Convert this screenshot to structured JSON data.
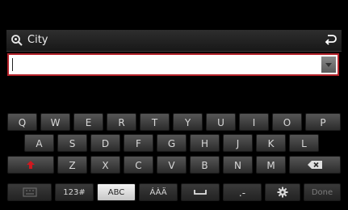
{
  "header": {
    "title": "City"
  },
  "input": {
    "value": ""
  },
  "keyboard": {
    "row1": [
      "Q",
      "W",
      "E",
      "R",
      "T",
      "Y",
      "U",
      "I",
      "O",
      "P"
    ],
    "row2": [
      "A",
      "S",
      "D",
      "F",
      "G",
      "H",
      "J",
      "K",
      "L"
    ],
    "row3": [
      "Z",
      "X",
      "C",
      "V",
      "B",
      "N",
      "M"
    ],
    "bottom": {
      "numbers_label": "123#",
      "abc_label": "ABC",
      "accents_label": "ÁÀÄ",
      "symbols_label": ".-",
      "done_label": "Done"
    }
  },
  "colors": {
    "input_border": "#b3222a",
    "shift_arrow": "#d0181f",
    "selected_key": "#e6e6e6"
  },
  "icons": {
    "search": "search-icon",
    "back": "back-arrow-icon",
    "dropdown": "dropdown-arrow-icon",
    "shift": "shift-arrow-icon",
    "backspace": "backspace-icon",
    "keyboard": "keyboard-icon",
    "space": "space-bar-icon",
    "settings": "gear-icon"
  }
}
